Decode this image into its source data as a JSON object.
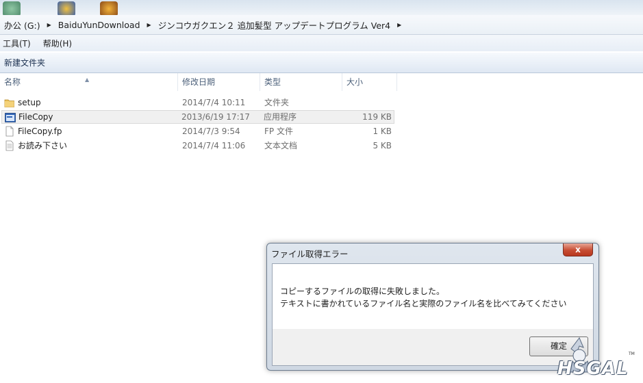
{
  "address": {
    "crumbs": [
      "办公 (G:)",
      "BaiduYunDownload",
      "ジンコウガクエン２ 追加髪型 アップデートプログラム Ver4"
    ]
  },
  "menu": {
    "items": [
      "工具(T)",
      "帮助(H)"
    ]
  },
  "toolbar": {
    "new_folder": "新建文件夹"
  },
  "columns": {
    "name": "名称",
    "date": "修改日期",
    "type": "类型",
    "size": "大小"
  },
  "files": [
    {
      "icon": "folder-icon",
      "name": "setup",
      "date": "2014/7/4 10:11",
      "type": "文件夹",
      "size": ""
    },
    {
      "icon": "application-icon",
      "name": "FileCopy",
      "date": "2013/6/19 17:17",
      "type": "应用程序",
      "size": "119 KB",
      "selected": true
    },
    {
      "icon": "document-icon",
      "name": "FileCopy.fp",
      "date": "2014/7/3 9:54",
      "type": "FP 文件",
      "size": "1 KB"
    },
    {
      "icon": "text-document-icon",
      "name": "お読み下さい",
      "date": "2014/7/4 11:06",
      "type": "文本文档",
      "size": "5 KB"
    }
  ],
  "dialog": {
    "title": "ファイル取得エラー",
    "close": "x",
    "message_line1": "コピーするファイルの取得に失敗しました。",
    "message_line2": "テキストに書かれているファイル名と実際のファイル名を比べてみてください",
    "ok_label": "確定"
  },
  "watermark": {
    "logo_text": "HSGAL",
    "tm": "TM"
  },
  "colors": {
    "selection": "#f0f0f0",
    "close_button": "#c74d33",
    "toolbar_text": "#1a2f4f",
    "column_header_text": "#4c607a"
  }
}
